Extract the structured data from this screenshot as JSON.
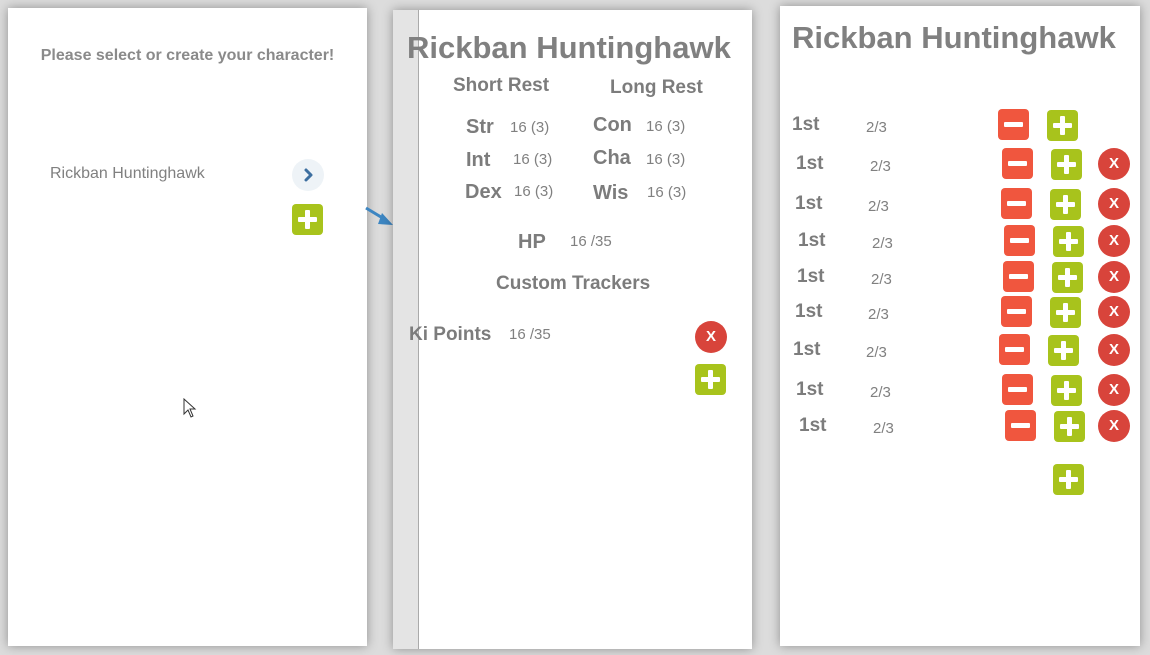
{
  "select_screen": {
    "prompt": "Please select or create your character!",
    "characters": [
      {
        "name": "Rickban Huntinghawk"
      }
    ]
  },
  "character_screen": {
    "name": "Rickban Huntinghawk",
    "short_rest_label": "Short Rest",
    "long_rest_label": "Long Rest",
    "stats": [
      {
        "label": "Str",
        "value": "16 (3)"
      },
      {
        "label": "Int",
        "value": "16 (3)"
      },
      {
        "label": "Dex",
        "value": "16 (3)"
      },
      {
        "label": "Con",
        "value": "16 (3)"
      },
      {
        "label": "Cha",
        "value": "16 (3)"
      },
      {
        "label": "Wis",
        "value": "16 (3)"
      }
    ],
    "hp": {
      "label": "HP",
      "value": "16 /35"
    },
    "custom_trackers_label": "Custom Trackers",
    "trackers": [
      {
        "label": "Ki Points",
        "value": "16 /35",
        "remove_label": "X"
      }
    ]
  },
  "spell_slots_screen": {
    "name": "Rickban Huntinghawk",
    "slots": [
      {
        "level": "1st",
        "count": "2/3"
      },
      {
        "level": "1st",
        "count": "2/3",
        "remove_label": "X"
      },
      {
        "level": "1st",
        "count": "2/3",
        "remove_label": "X"
      },
      {
        "level": "1st",
        "count": "2/3",
        "remove_label": "X"
      },
      {
        "level": "1st",
        "count": "2/3",
        "remove_label": "X"
      },
      {
        "level": "1st",
        "count": "2/3",
        "remove_label": "X"
      },
      {
        "level": "1st",
        "count": "2/3",
        "remove_label": "X"
      },
      {
        "level": "1st",
        "count": "2/3",
        "remove_label": "X"
      },
      {
        "level": "1st",
        "count": "2/3",
        "remove_label": "X"
      }
    ]
  },
  "colors": {
    "add_button": "#a8c31c",
    "decrement_button": "#f0563e",
    "remove_button": "#d8443b",
    "arrow": "#3d86c2",
    "text": "#808080"
  }
}
